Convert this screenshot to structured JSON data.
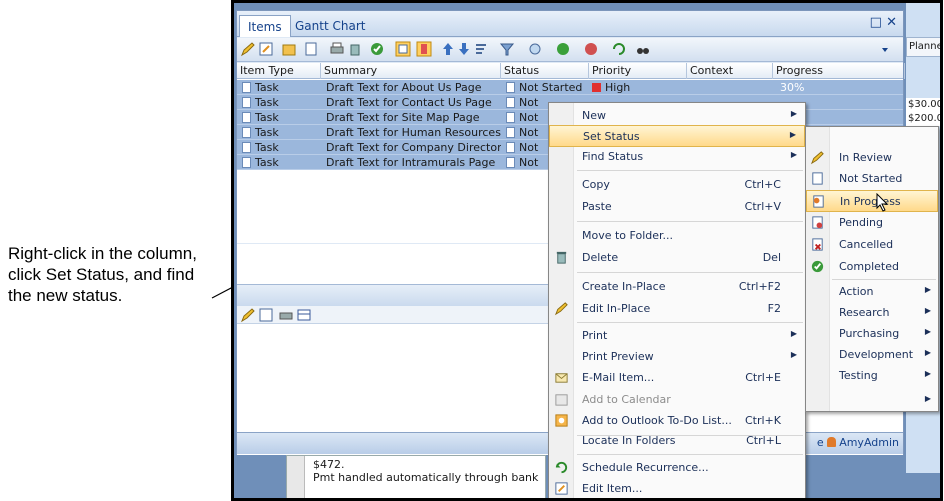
{
  "callout": {
    "text": "Right-click in the column, click Set Status, and find the new status."
  },
  "background_window": {
    "column_header": "Planne",
    "cells": [
      "$30.00",
      "$200.0"
    ]
  },
  "tabs": [
    {
      "label": "Items"
    },
    {
      "label": "Gantt Chart"
    }
  ],
  "window_controls": {
    "pin": "□",
    "close": "✕"
  },
  "grid": {
    "columns": [
      "Item Type",
      "Summary",
      "Status",
      "Priority",
      "Context",
      "Progress"
    ],
    "rows": [
      {
        "type": "Task",
        "summary": "Draft Text for About Us Page",
        "status": "Not Started",
        "priority": "High",
        "progress": "30%"
      },
      {
        "type": "Task",
        "summary": "Draft Text for Contact Us Page",
        "status": "Not"
      },
      {
        "type": "Task",
        "summary": "Draft Text for Site Map Page",
        "status": "Not"
      },
      {
        "type": "Task",
        "summary": "Draft Text for Human Resources Page",
        "status": "Not"
      },
      {
        "type": "Task",
        "summary": "Draft Text for Company Directory Pa",
        "status": "Not"
      },
      {
        "type": "Task",
        "summary": "Draft Text for Intramurals Page",
        "status": "Not"
      }
    ]
  },
  "status_bar": {
    "user_suffix": "e",
    "user": "AmyAdmin"
  },
  "note": {
    "line1": "$472.",
    "line2": "Pmt handled automatically through bank"
  },
  "context_menu": {
    "items": [
      {
        "label": "New",
        "shortcut": "",
        "submenu": true
      },
      {
        "label": "Set Status",
        "shortcut": "",
        "submenu": true,
        "highlighted": true
      },
      {
        "label": "Find Status",
        "shortcut": "",
        "submenu": true
      },
      {
        "label": "Copy",
        "shortcut": "Ctrl+C"
      },
      {
        "label": "Paste",
        "shortcut": "Ctrl+V"
      },
      {
        "label": "Move to Folder...",
        "shortcut": ""
      },
      {
        "label": "Delete",
        "shortcut": "Del",
        "icon": "recycle-bin-icon"
      },
      {
        "label": "Create In-Place",
        "shortcut": "Ctrl+F2"
      },
      {
        "label": "Edit In-Place",
        "shortcut": "F2",
        "icon": "pencil-icon"
      },
      {
        "label": "Print",
        "shortcut": "",
        "submenu": true
      },
      {
        "label": "Print Preview",
        "shortcut": "",
        "submenu": true
      },
      {
        "label": "E-Mail Item...",
        "shortcut": "Ctrl+E",
        "icon": "email-icon"
      },
      {
        "label": "Add to Calendar",
        "shortcut": "",
        "disabled": true,
        "icon": "calendar-icon"
      },
      {
        "label": "Add to Outlook To-Do List...",
        "shortcut": "Ctrl+K",
        "icon": "outlook-icon"
      },
      {
        "label": "Locate In Folders",
        "shortcut": "Ctrl+L"
      },
      {
        "label": "Schedule Recurrence...",
        "shortcut": "",
        "icon": "recurrence-icon"
      },
      {
        "label": "Edit Item...",
        "shortcut": "",
        "icon": "edit-item-icon"
      }
    ]
  },
  "status_submenu": {
    "items": [
      {
        "label": "In Review",
        "icon": "pencil-icon"
      },
      {
        "label": "Not Started",
        "icon": "page-icon"
      },
      {
        "label": "In Progress",
        "icon": "in-progress-icon",
        "highlighted": true
      },
      {
        "label": "Pending",
        "icon": "pending-icon"
      },
      {
        "label": "Cancelled",
        "icon": "cancelled-icon"
      },
      {
        "label": "Completed",
        "icon": "check-icon"
      },
      {
        "label": "Action",
        "submenu": true
      },
      {
        "label": "Research",
        "submenu": true
      },
      {
        "label": "Purchasing",
        "submenu": true
      },
      {
        "label": "Development",
        "submenu": true
      },
      {
        "label": "Testing",
        "submenu": true
      },
      {
        "label": "",
        "submenu": true
      }
    ]
  },
  "colors": {
    "selection": "#9bb7dc",
    "menu_highlight": "#ffd98a",
    "accent": "#15428b"
  }
}
